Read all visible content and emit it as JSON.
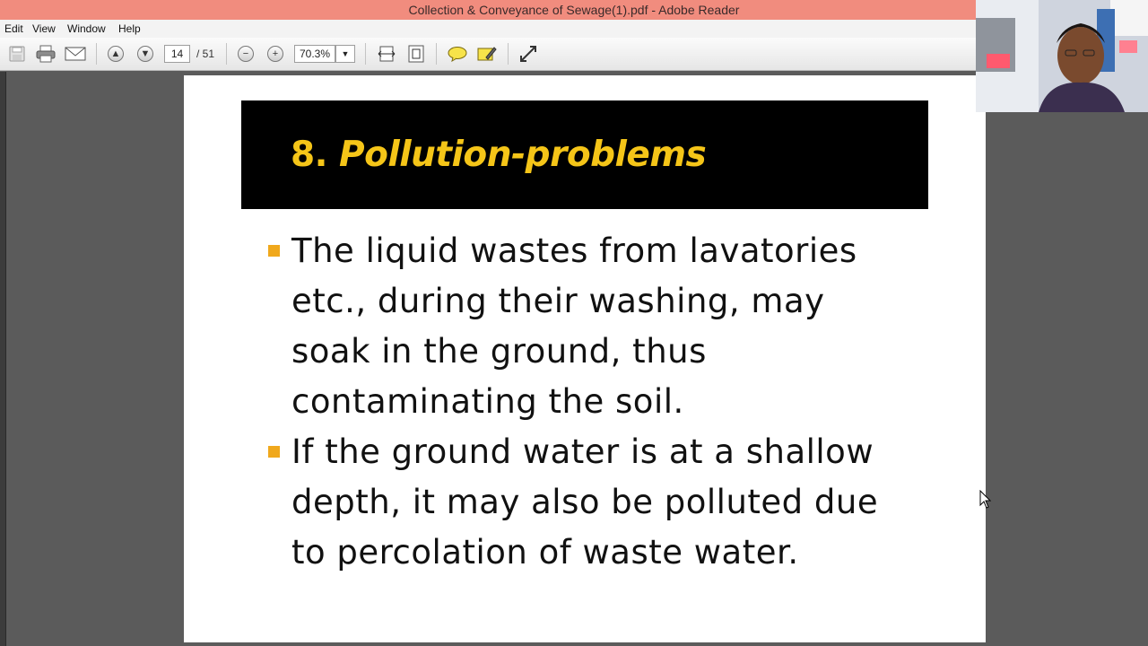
{
  "window": {
    "title": "Collection & Conveyance of Sewage(1).pdf - Adobe Reader"
  },
  "menu": {
    "items": [
      "Edit",
      "View",
      "Window",
      "Help"
    ]
  },
  "toolbar": {
    "page_current": "14",
    "page_total": "/ 51",
    "zoom": "70.3%"
  },
  "slide": {
    "title_number": "8.",
    "title_text": "Pollution-problems",
    "bullets": [
      "The liquid wastes from lavatories etc., during their washing, may soak in the ground, thus contaminating the soil.",
      " If the ground water is at a shallow depth, it may also be polluted due to percolation of waste water."
    ],
    "title_color": "#f5c518",
    "bullet_color": "#f0a81c"
  }
}
